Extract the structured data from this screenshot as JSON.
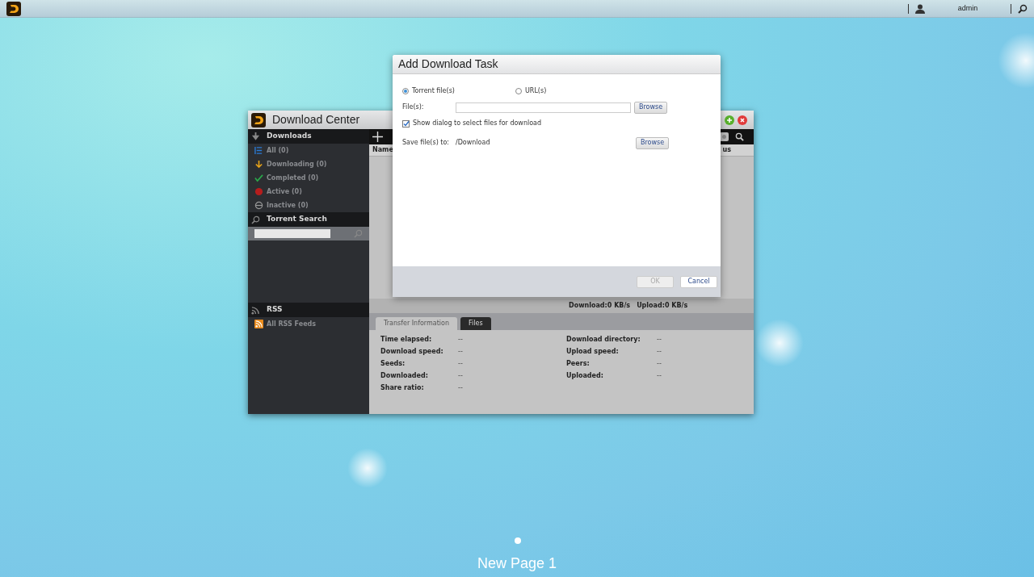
{
  "taskbar": {
    "user": "admin"
  },
  "window": {
    "title": "Download Center",
    "sidebar": [
      {
        "title": "Downloads",
        "kind": "list",
        "items": [
          {
            "label": "All (0)",
            "kind": "all"
          },
          {
            "label": "Downloading (0)",
            "kind": "downloading"
          },
          {
            "label": "Completed (0)",
            "kind": "completed"
          },
          {
            "label": "Active (0)",
            "kind": "active"
          },
          {
            "label": "Inactive (0)",
            "kind": "inactive"
          }
        ]
      },
      {
        "title": "Torrent Search",
        "kind": "search"
      },
      {
        "title": "RSS",
        "kind": "list",
        "items": [
          {
            "label": "All RSS Feeds",
            "kind": "rss"
          }
        ]
      }
    ],
    "columns": [
      "Name",
      "us"
    ],
    "status": [
      "Download:0 KB/s",
      "Upload:0 KB/s"
    ],
    "tabs": [
      {
        "label": "Transfer Information",
        "selected": true
      },
      {
        "label": "Files",
        "selected": false
      }
    ],
    "info_left": [
      {
        "label": "Time elapsed:",
        "value": "--"
      },
      {
        "label": "Download speed:",
        "value": "--"
      },
      {
        "label": "Seeds:",
        "value": "--"
      },
      {
        "label": "Downloaded:",
        "value": "--"
      },
      {
        "label": "Share ratio:",
        "value": "--"
      }
    ],
    "info_right": [
      {
        "label": "Download directory:",
        "value": "--"
      },
      {
        "label": "Upload speed:",
        "value": "--"
      },
      {
        "label": "Peers:",
        "value": "--"
      },
      {
        "label": "Uploaded:",
        "value": "--"
      }
    ]
  },
  "dialog": {
    "title": "Add Download Task",
    "sources": [
      {
        "label": "Torrent file(s)",
        "selected": true
      },
      {
        "label": "URL(s)",
        "selected": false
      }
    ],
    "file": {
      "label": "File(s):",
      "button": "Browse"
    },
    "show_dialog": {
      "label": "Show dialog to select files for download",
      "checked": true
    },
    "save": {
      "label": "Save file(s) to:",
      "value": "/Download",
      "button": "Browse"
    },
    "buttons": [
      {
        "label": "OK",
        "disabled": true
      },
      {
        "label": "Cancel",
        "disabled": false
      }
    ]
  },
  "page_label": "New Page 1"
}
